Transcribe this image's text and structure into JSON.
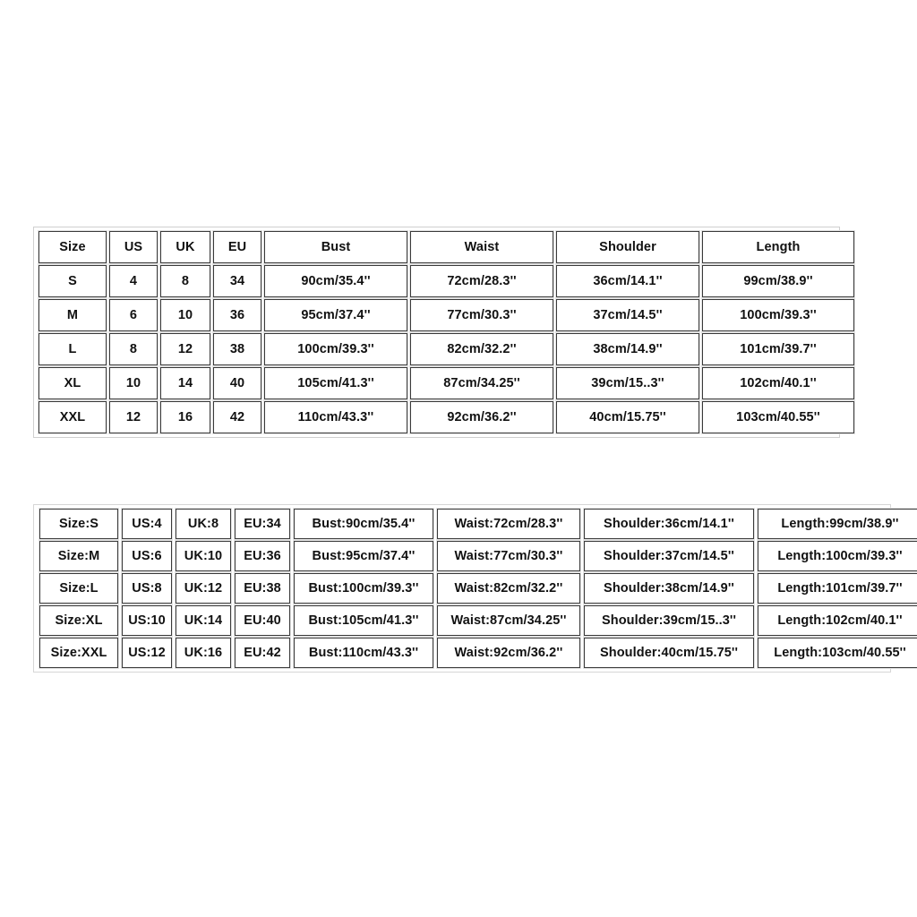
{
  "size_chart": {
    "columns": [
      "Size",
      "US",
      "UK",
      "EU",
      "Bust",
      "Waist",
      "Shoulder",
      "Length"
    ],
    "rows": [
      {
        "size": "S",
        "us": "4",
        "uk": "8",
        "eu": "34",
        "bust": "90cm/35.4''",
        "waist": "72cm/28.3''",
        "shoulder": "36cm/14.1''",
        "length": "99cm/38.9''"
      },
      {
        "size": "M",
        "us": "6",
        "uk": "10",
        "eu": "36",
        "bust": "95cm/37.4''",
        "waist": "77cm/30.3''",
        "shoulder": "37cm/14.5''",
        "length": "100cm/39.3''"
      },
      {
        "size": "L",
        "us": "8",
        "uk": "12",
        "eu": "38",
        "bust": "100cm/39.3''",
        "waist": "82cm/32.2''",
        "shoulder": "38cm/14.9''",
        "length": "101cm/39.7''"
      },
      {
        "size": "XL",
        "us": "10",
        "uk": "14",
        "eu": "40",
        "bust": "105cm/41.3''",
        "waist": "87cm/34.25''",
        "shoulder": "39cm/15..3''",
        "length": "102cm/40.1''"
      },
      {
        "size": "XXL",
        "us": "12",
        "uk": "16",
        "eu": "42",
        "bust": "110cm/43.3''",
        "waist": "92cm/36.2''",
        "shoulder": "40cm/15.75''",
        "length": "103cm/40.55''"
      }
    ]
  },
  "size_chart_labelled": {
    "rows": [
      {
        "size": "Size:S",
        "us": "US:4",
        "uk": "UK:8",
        "eu": "EU:34",
        "bust": "Bust:90cm/35.4''",
        "waist": "Waist:72cm/28.3''",
        "shoulder": "Shoulder:36cm/14.1''",
        "length": "Length:99cm/38.9''"
      },
      {
        "size": "Size:M",
        "us": "US:6",
        "uk": "UK:10",
        "eu": "EU:36",
        "bust": "Bust:95cm/37.4''",
        "waist": "Waist:77cm/30.3''",
        "shoulder": "Shoulder:37cm/14.5''",
        "length": "Length:100cm/39.3''"
      },
      {
        "size": "Size:L",
        "us": "US:8",
        "uk": "UK:12",
        "eu": "EU:38",
        "bust": "Bust:100cm/39.3''",
        "waist": "Waist:82cm/32.2''",
        "shoulder": "Shoulder:38cm/14.9''",
        "length": "Length:101cm/39.7''"
      },
      {
        "size": "Size:XL",
        "us": "US:10",
        "uk": "UK:14",
        "eu": "EU:40",
        "bust": "Bust:105cm/41.3''",
        "waist": "Waist:87cm/34.25''",
        "shoulder": "Shoulder:39cm/15..3''",
        "length": "Length:102cm/40.1''"
      },
      {
        "size": "Size:XXL",
        "us": "US:12",
        "uk": "UK:16",
        "eu": "EU:42",
        "bust": "Bust:110cm/43.3''",
        "waist": "Waist:92cm/36.2''",
        "shoulder": "Shoulder:40cm/15.75''",
        "length": "Length:103cm/40.55''"
      }
    ]
  },
  "colors": {
    "page_background": "#ffffff",
    "cell_border": "#3a3a3a",
    "outer_frame": "#cfcfcf",
    "text": "#111111"
  }
}
